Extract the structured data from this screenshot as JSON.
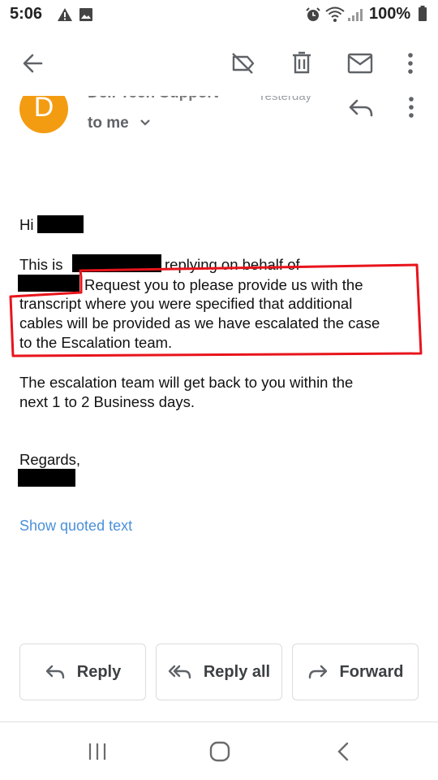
{
  "status_bar": {
    "time": "5:06",
    "battery": "100%"
  },
  "email": {
    "sender": "Dell Tech Support",
    "date": "Yesterday",
    "avatar_letter": "D",
    "recipient": "to me",
    "greeting": "Hi",
    "para1": {
      "line1_a": "This is",
      "line1_b": "replying on behalf of",
      "line2": "Request you to please provide us with the",
      "line3": "transcript where you were specified that additional",
      "line4": "cables will be provided as we have escalated the case",
      "line5": "to the Escalation team."
    },
    "para2": {
      "line1": "The escalation team will get back to you within the",
      "line2": "next 1 to 2 Business days."
    },
    "closing": "Regards,",
    "show_quoted": "Show quoted text"
  },
  "actions": {
    "reply": "Reply",
    "reply_all": "Reply all",
    "forward": "Forward"
  },
  "colors": {
    "avatar": "#f39c12",
    "highlight": "#e8141c",
    "link": "#4a90d9"
  },
  "icons": [
    "back-arrow-icon",
    "label-off-icon",
    "delete-icon",
    "mail-icon",
    "more-vert-icon",
    "reply-icon",
    "reply-all-icon",
    "forward-icon"
  ]
}
